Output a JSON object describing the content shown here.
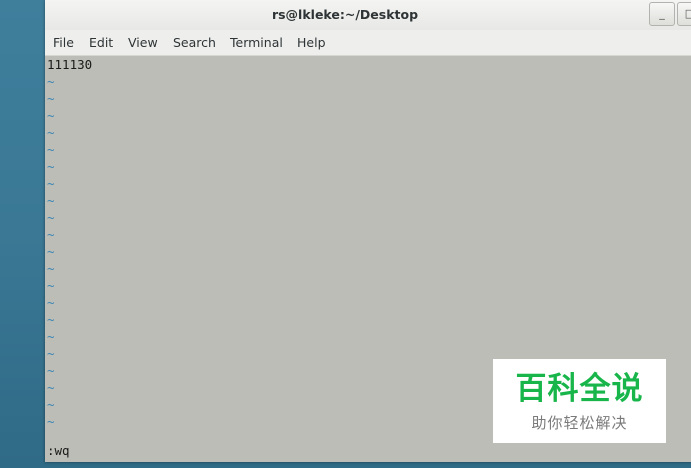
{
  "window": {
    "title": "rs@lkleke:~/Desktop",
    "minimize_glyph": "_",
    "maximize_glyph": "□"
  },
  "menu": {
    "items": [
      "File",
      "Edit",
      "View",
      "Search",
      "Terminal",
      "Help"
    ]
  },
  "terminal": {
    "text_line": "111130",
    "tilde": "~",
    "command": ":wq"
  },
  "watermark": {
    "title": "百科全说",
    "subtitle": "助你轻松解决"
  },
  "colors": {
    "terminal_bg": "#bbbdb6",
    "tilde": "#3b86b5",
    "watermark_green": "#18b64a"
  }
}
